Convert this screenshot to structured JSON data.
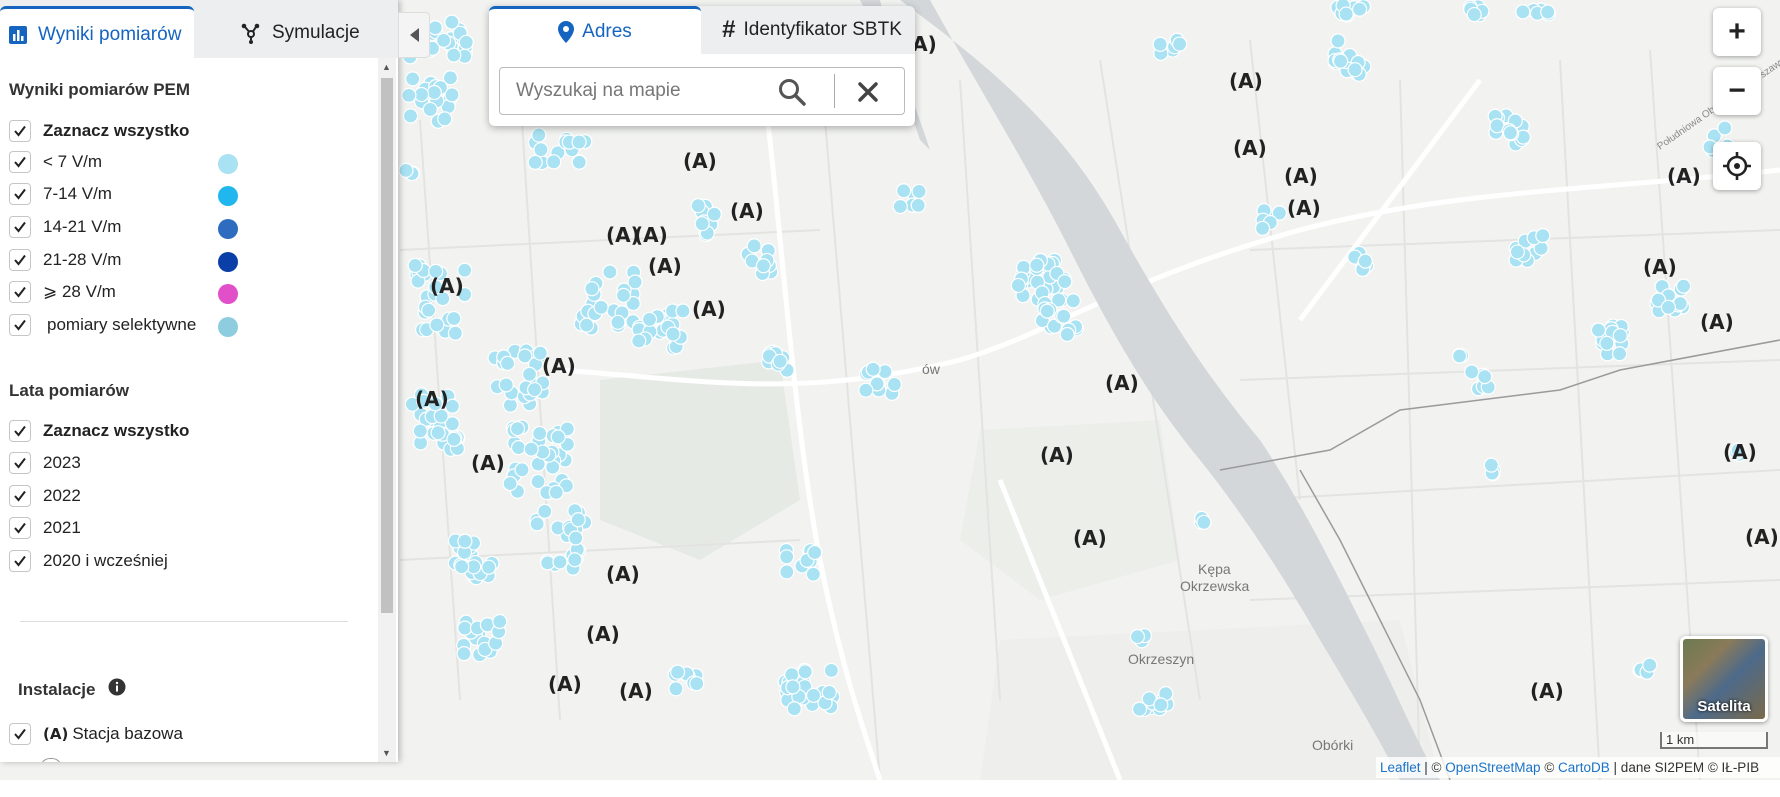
{
  "left_tabs": [
    {
      "label": "Wyniki pomiarów",
      "active": true,
      "icon": "bar-chart-icon"
    },
    {
      "label": "Symulacje",
      "active": false,
      "icon": "network-icon"
    }
  ],
  "results": {
    "title": "Wyniki pomiarów PEM",
    "select_all": "Zaznacz wszystko",
    "levels": [
      {
        "label": "< 7 V/m",
        "color": "#a9e2f2",
        "checked": true
      },
      {
        "label": "7-14 V/m",
        "color": "#20b7ef",
        "checked": true
      },
      {
        "label": "14-21 V/m",
        "color": "#2e6cc0",
        "checked": true
      },
      {
        "label": "21-28 V/m",
        "color": "#0a3fa7",
        "checked": true
      },
      {
        "label": "⩾ 28 V/m",
        "color": "#e14fc9",
        "checked": true
      },
      {
        "label": "pomiary selektywne",
        "color": "#8ecde0",
        "checked": true
      }
    ]
  },
  "years": {
    "title": "Lata pomiarów",
    "select_all": "Zaznacz wszystko",
    "items": [
      "2023",
      "2022",
      "2021",
      "2020 i wcześniej"
    ]
  },
  "installations": {
    "title": "Instalacje",
    "items": [
      {
        "label": "Stacja bazowa",
        "checked": true
      }
    ]
  },
  "search": {
    "tabs": [
      {
        "label": "Adres",
        "active": true,
        "icon": "map-pin-icon"
      },
      {
        "label": "Identyfikator SBTK",
        "active": false,
        "icon": "hash-icon"
      }
    ],
    "placeholder": "Wyszukaj na mapie",
    "value": ""
  },
  "map": {
    "labels": {
      "river_road": "Południowa Obwodnica Warszawy",
      "kepa": "Kępa",
      "okrzewska": "Okrzewska",
      "okrzeszyn": "Okrzeszyn",
      "oborki": "Obórki",
      "wilanow_fragment": "ów"
    },
    "controls": {
      "zoom_in": "+",
      "zoom_out": "−",
      "locate_icon": "crosshair-icon"
    },
    "satellite_label": "Satelita",
    "scale_label": "1 km",
    "attribution": {
      "leaflet": "Leaflet",
      "sep1": " | © ",
      "osm": "OpenStreetMap",
      "sep2": " © ",
      "carto": "CartoDB",
      "rest": " | dane SI2PEM © IŁ-PIB"
    },
    "colors": {
      "water": "#d3d7da",
      "road": "#ffffff",
      "land": "#f2f3f1",
      "park": "#e6eae4",
      "boundary": "#9a9a9a"
    }
  }
}
